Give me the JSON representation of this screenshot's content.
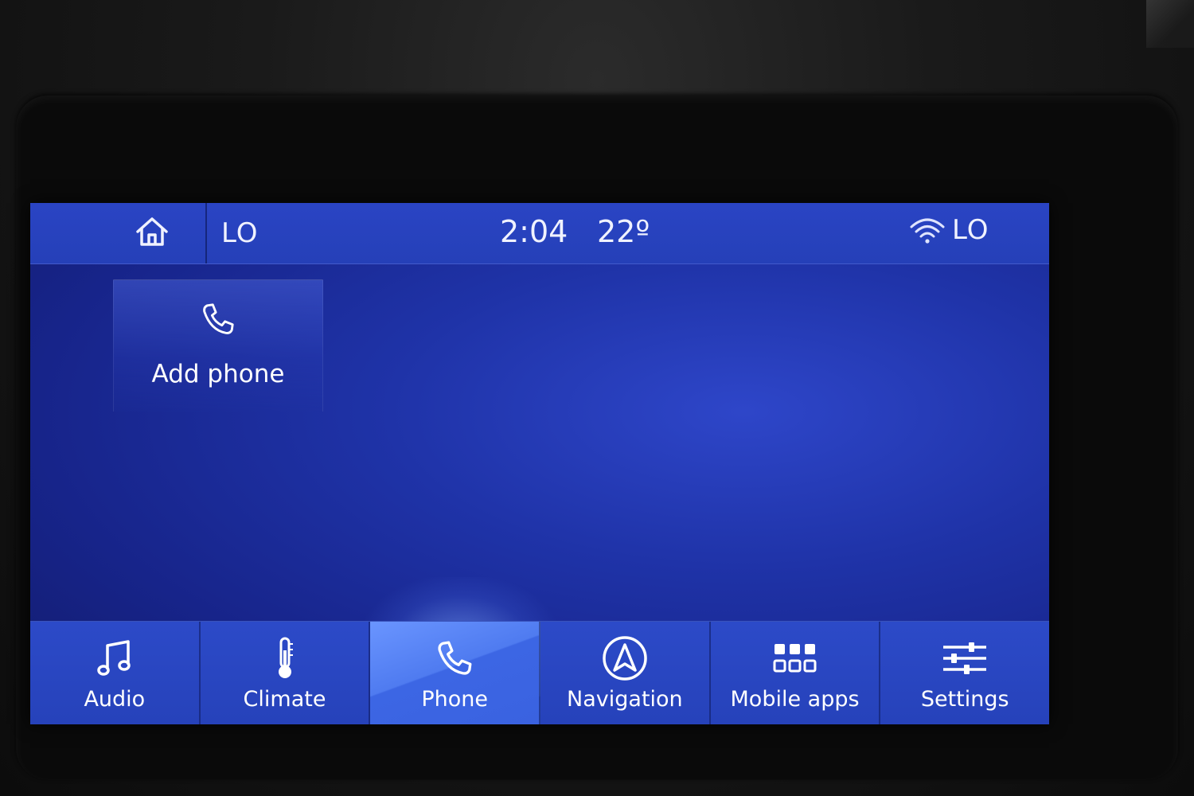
{
  "status_bar": {
    "left_label": "LO",
    "time": "2:04",
    "temperature": "22º",
    "right_label": "LO",
    "icons": {
      "home": "home-icon",
      "wifi": "wifi-icon"
    }
  },
  "main": {
    "add_phone": {
      "label": "Add phone",
      "icon": "phone-icon"
    }
  },
  "nav": {
    "items": [
      {
        "label": "Audio",
        "icon": "music-note-icon",
        "active": false
      },
      {
        "label": "Climate",
        "icon": "thermometer-icon",
        "active": false
      },
      {
        "label": "Phone",
        "icon": "phone-icon",
        "active": true
      },
      {
        "label": "Navigation",
        "icon": "navigation-icon",
        "active": false
      },
      {
        "label": "Mobile apps",
        "icon": "apps-grid-icon",
        "active": false
      },
      {
        "label": "Settings",
        "icon": "settings-sliders-icon",
        "active": false
      }
    ]
  },
  "colors": {
    "screen_blue": "#1f33a8",
    "active_tab": "#4f7bf0",
    "text": "#ffffff"
  }
}
